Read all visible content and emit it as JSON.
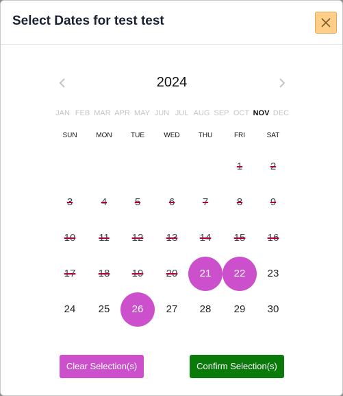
{
  "modal": {
    "title": "Select Dates for test test",
    "close_icon": "close-icon",
    "colors": {
      "close_bg": "#ffcf8a",
      "selected": "#cc4fcc",
      "confirm": "#0a7a0a",
      "strike": "#b0003a"
    }
  },
  "calendar": {
    "prev_icon": "chevron-left-icon",
    "next_icon": "chevron-right-icon",
    "year": "2024",
    "months": [
      "JAN",
      "FEB",
      "MAR",
      "APR",
      "MAY",
      "JUN",
      "JUL",
      "AUG",
      "SEP",
      "OCT",
      "NOV",
      "DEC"
    ],
    "current_month": "NOV",
    "weekdays": [
      "SUN",
      "MON",
      "TUE",
      "WED",
      "THU",
      "FRI",
      "SAT"
    ],
    "days": [
      {
        "label": "1",
        "state": "disabled"
      },
      {
        "label": "2",
        "state": "disabled"
      },
      {
        "label": "3",
        "state": "disabled"
      },
      {
        "label": "4",
        "state": "disabled"
      },
      {
        "label": "5",
        "state": "disabled"
      },
      {
        "label": "6",
        "state": "disabled"
      },
      {
        "label": "7",
        "state": "disabled"
      },
      {
        "label": "8",
        "state": "disabled"
      },
      {
        "label": "9",
        "state": "disabled"
      },
      {
        "label": "10",
        "state": "disabled"
      },
      {
        "label": "11",
        "state": "disabled"
      },
      {
        "label": "12",
        "state": "disabled"
      },
      {
        "label": "13",
        "state": "disabled"
      },
      {
        "label": "14",
        "state": "disabled"
      },
      {
        "label": "15",
        "state": "disabled"
      },
      {
        "label": "16",
        "state": "disabled"
      },
      {
        "label": "17",
        "state": "disabled"
      },
      {
        "label": "18",
        "state": "disabled"
      },
      {
        "label": "19",
        "state": "disabled"
      },
      {
        "label": "20",
        "state": "disabled"
      },
      {
        "label": "21",
        "state": "selected"
      },
      {
        "label": "22",
        "state": "selected"
      },
      {
        "label": "23",
        "state": "available"
      },
      {
        "label": "24",
        "state": "available"
      },
      {
        "label": "25",
        "state": "available"
      },
      {
        "label": "26",
        "state": "selected"
      },
      {
        "label": "27",
        "state": "available"
      },
      {
        "label": "28",
        "state": "available"
      },
      {
        "label": "29",
        "state": "available"
      },
      {
        "label": "30",
        "state": "available"
      }
    ]
  },
  "actions": {
    "clear_label": "Clear Selection(s)",
    "confirm_label": "Confirm Selection(s)"
  }
}
